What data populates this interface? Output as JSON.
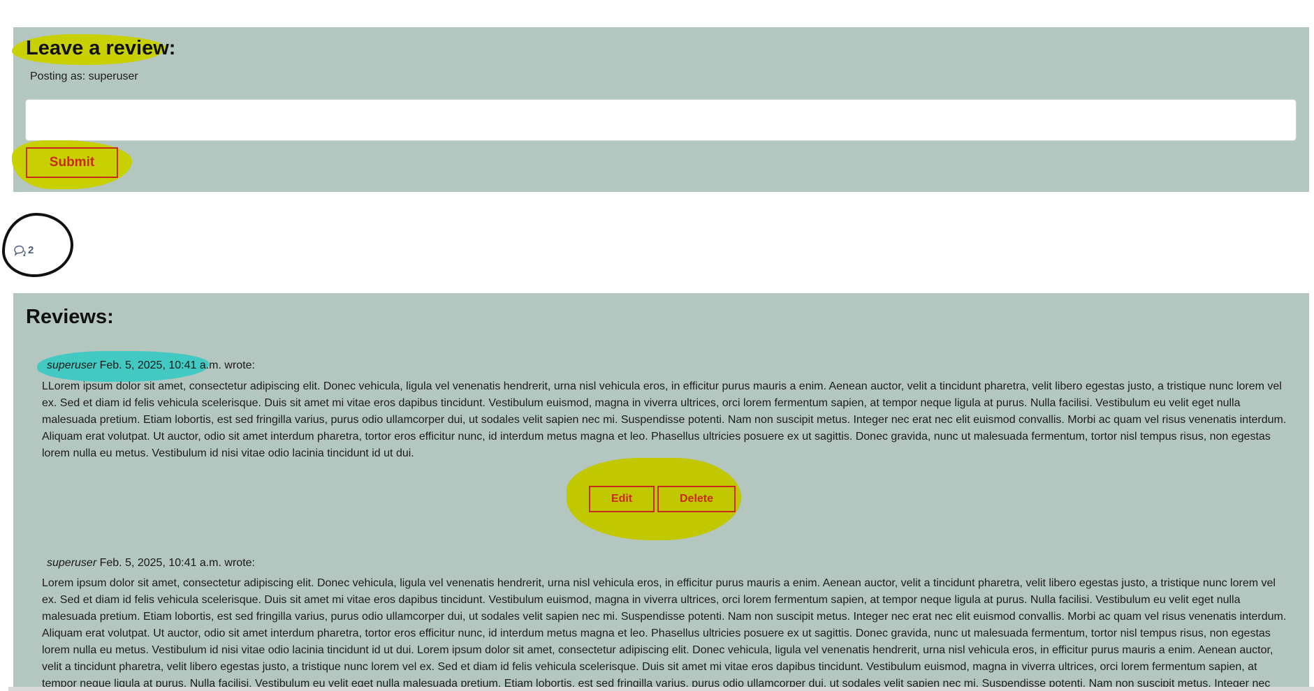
{
  "form": {
    "title": "Leave a review:",
    "posting_as": "Posting as: superuser",
    "textarea_value": "",
    "submit_label": "Submit"
  },
  "counter": {
    "icon": "comments-icon",
    "count": "2"
  },
  "reviews": {
    "title": "Reviews:",
    "items": [
      {
        "author": "superuser",
        "date": "Feb. 5, 2025, 10:41 a.m.",
        "wrote": "wrote:",
        "body": "LLorem ipsum dolor sit amet, consectetur adipiscing elit. Donec vehicula, ligula vel venenatis hendrerit, urna nisl vehicula eros, in efficitur purus mauris a enim. Aenean auctor, velit a tincidunt pharetra, velit libero egestas justo, a tristique nunc lorem vel ex. Sed et diam id felis vehicula scelerisque. Duis sit amet mi vitae eros dapibus tincidunt. Vestibulum euismod, magna in viverra ultrices, orci lorem fermentum sapien, at tempor neque ligula at purus. Nulla facilisi. Vestibulum eu velit eget nulla malesuada pretium. Etiam lobortis, est sed fringilla varius, purus odio ullamcorper dui, ut sodales velit sapien nec mi. Suspendisse potenti. Nam non suscipit metus. Integer nec erat nec elit euismod convallis. Morbi ac quam vel risus venenatis interdum. Aliquam erat volutpat. Ut auctor, odio sit amet interdum pharetra, tortor eros efficitur nunc, id interdum metus magna et leo. Phasellus ultricies posuere ex ut sagittis. Donec gravida, nunc ut malesuada fermentum, tortor nisl tempus risus, non egestas lorem nulla eu metus. Vestibulum id nisi vitae odio lacinia tincidunt id ut dui.",
        "edit_label": "Edit",
        "delete_label": "Delete"
      },
      {
        "author": "superuser",
        "date": "Feb. 5, 2025, 10:41 a.m.",
        "wrote": "wrote:",
        "body": "Lorem ipsum dolor sit amet, consectetur adipiscing elit. Donec vehicula, ligula vel venenatis hendrerit, urna nisl vehicula eros, in efficitur purus mauris a enim. Aenean auctor, velit a tincidunt pharetra, velit libero egestas justo, a tristique nunc lorem vel ex. Sed et diam id felis vehicula scelerisque. Duis sit amet mi vitae eros dapibus tincidunt. Vestibulum euismod, magna in viverra ultrices, orci lorem fermentum sapien, at tempor neque ligula at purus. Nulla facilisi. Vestibulum eu velit eget nulla malesuada pretium. Etiam lobortis, est sed fringilla varius, purus odio ullamcorper dui, ut sodales velit sapien nec mi. Suspendisse potenti. Nam non suscipit metus. Integer nec erat nec elit euismod convallis. Morbi ac quam vel risus venenatis interdum. Aliquam erat volutpat. Ut auctor, odio sit amet interdum pharetra, tortor eros efficitur nunc, id interdum metus magna et leo. Phasellus ultricies posuere ex ut sagittis. Donec gravida, nunc ut malesuada fermentum, tortor nisl tempus risus, non egestas lorem nulla eu metus. Vestibulum id nisi vitae odio lacinia tincidunt id ut dui. Lorem ipsum dolor sit amet, consectetur adipiscing elit. Donec vehicula, ligula vel venenatis hendrerit, urna nisl vehicula eros, in efficitur purus mauris a enim. Aenean auctor, velit a tincidunt pharetra, velit libero egestas justo, a tristique nunc lorem vel ex. Sed et diam id felis vehicula scelerisque. Duis sit amet mi vitae eros dapibus tincidunt. Vestibulum euismod, magna in viverra ultrices, orci lorem fermentum sapien, at tempor neque ligula at purus. Nulla facilisi. Vestibulum eu velit eget nulla malesuada pretium. Etiam lobortis, est sed fringilla varius, purus odio ullamcorper dui, ut sodales velit sapien nec mi. Suspendisse potenti. Nam non suscipit metus. Integer nec"
      }
    ]
  },
  "colors": {
    "panel": "#b3c6bf",
    "button": "#c82a1c",
    "highlight_yellow": "#c8d000",
    "highlight_teal": "#42c9c2",
    "count": "#4a5d80"
  }
}
